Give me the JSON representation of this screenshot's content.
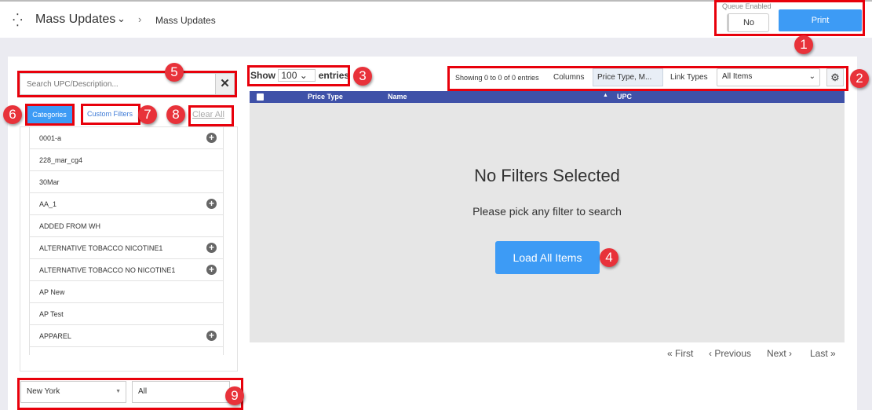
{
  "header": {
    "title": "Mass Updates",
    "breadcrumb": "Mass Updates",
    "queue_label": "Queue Enabled",
    "queue_value": "No",
    "print_label": "Print"
  },
  "search": {
    "placeholder": "Search UPC/Description..."
  },
  "tabs": {
    "categories": "Categories",
    "custom_filters": "Custom Filters",
    "clear_all": "Clear All"
  },
  "categories": [
    {
      "label": "0001-a",
      "expandable": true
    },
    {
      "label": "228_mar_cg4",
      "expandable": false
    },
    {
      "label": "30Mar",
      "expandable": false
    },
    {
      "label": "AA_1",
      "expandable": true
    },
    {
      "label": "ADDED FROM WH",
      "expandable": false
    },
    {
      "label": "ALTERNATIVE TOBACCO NICOTINE1",
      "expandable": true
    },
    {
      "label": "ALTERNATIVE TOBACCO NO NICOTINE1",
      "expandable": true
    },
    {
      "label": "AP New",
      "expandable": false
    },
    {
      "label": "AP Test",
      "expandable": false
    },
    {
      "label": "APPAREL",
      "expandable": true
    }
  ],
  "footer_selects": {
    "store": "New York",
    "all": "All"
  },
  "table": {
    "show_label": "Show",
    "entries_value": "100",
    "entries_label": "entries",
    "info": "Showing 0 to 0 of 0 entries",
    "columns_label": "Columns",
    "columns_value": "Price Type, M...",
    "link_types_label": "Link Types",
    "link_types_value": "All Items",
    "headers": [
      "Price Type",
      "Name",
      "UPC"
    ],
    "empty_title": "No Filters Selected",
    "empty_sub": "Please pick any filter to search",
    "load_all": "Load All Items"
  },
  "pagination": {
    "first": "« First",
    "previous": "‹ Previous",
    "next": "Next ›",
    "last": "Last »"
  },
  "annotations": [
    "1",
    "2",
    "3",
    "4",
    "5",
    "6",
    "7",
    "8",
    "9"
  ],
  "colors": {
    "accent": "#3d9bf5",
    "table_header": "#3f51a8",
    "annotation": "#e8000b"
  }
}
